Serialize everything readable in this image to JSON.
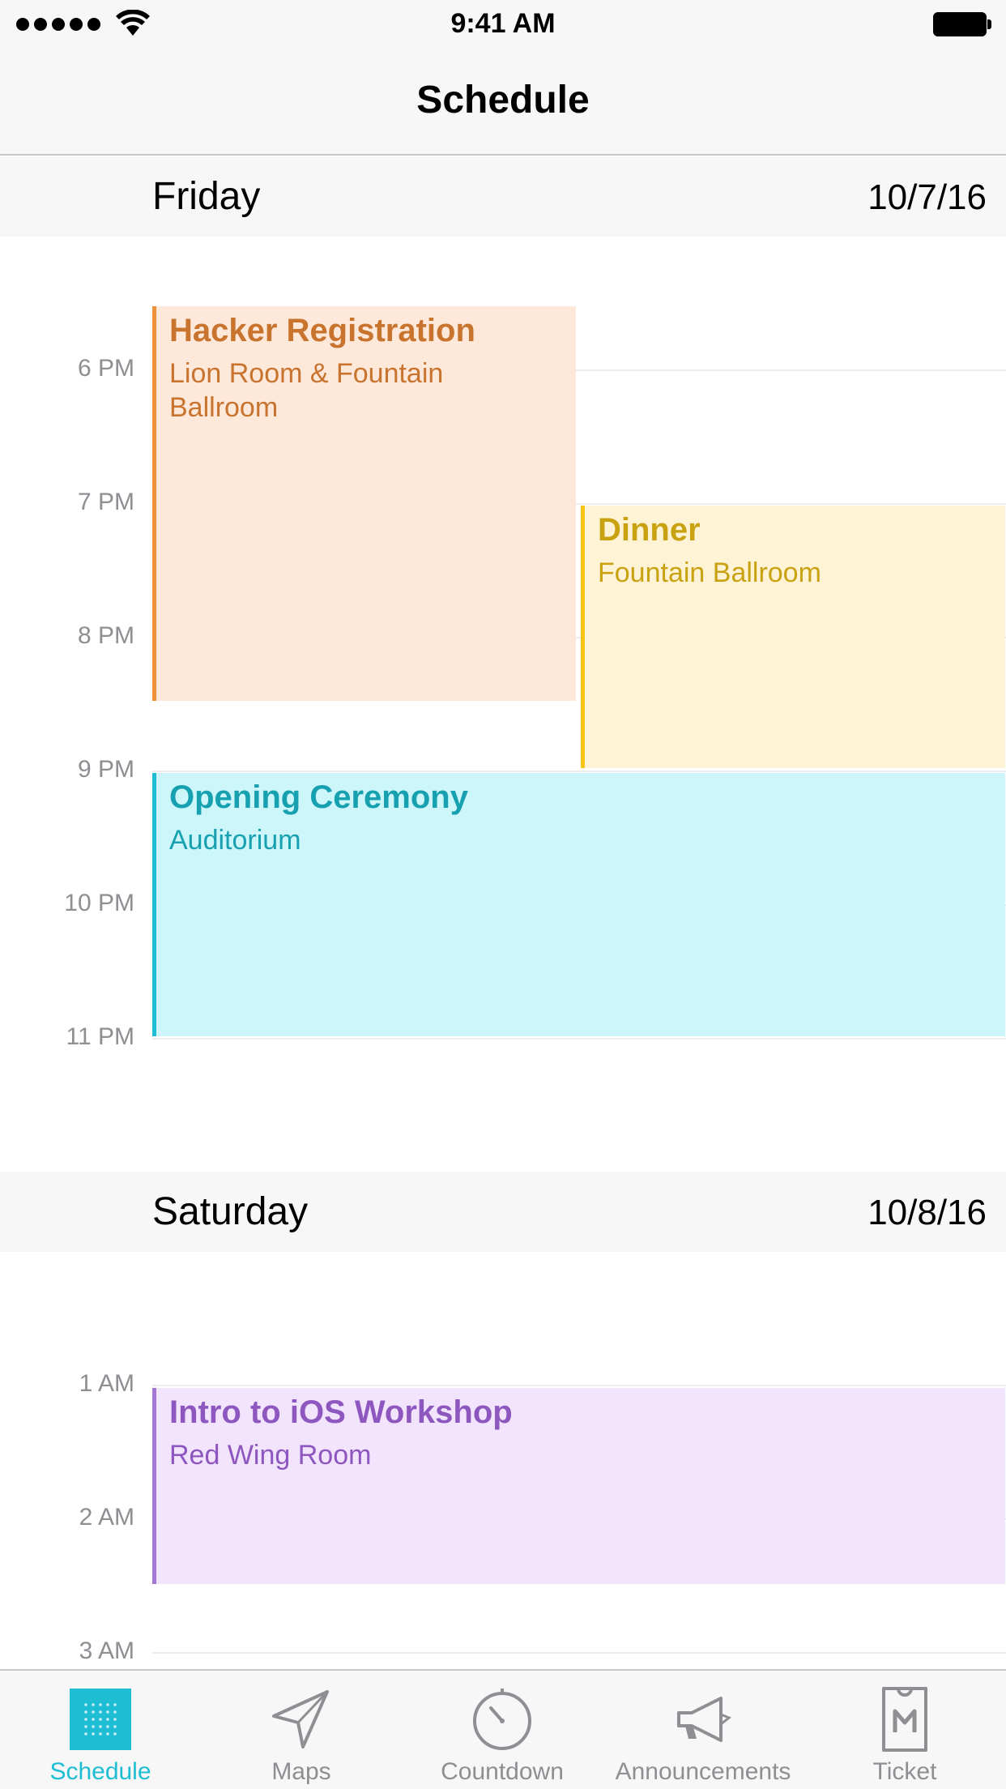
{
  "status_bar": {
    "time": "9:41 AM"
  },
  "nav": {
    "title": "Schedule"
  },
  "days": [
    {
      "name": "Friday",
      "date": "10/7/16",
      "hours": [
        "6 PM",
        "7 PM",
        "8 PM",
        "9 PM",
        "10 PM",
        "11 PM"
      ],
      "events": [
        {
          "title": "Hacker Registration",
          "location_line1": "Lion Room & Fountain",
          "location_line2": "Ballroom"
        },
        {
          "title": "Dinner",
          "location": "Fountain Ballroom"
        },
        {
          "title": "Opening Ceremony",
          "location": "Auditorium"
        }
      ]
    },
    {
      "name": "Saturday",
      "date": "10/8/16",
      "hours": [
        "1 AM",
        "2 AM",
        "3 AM"
      ],
      "events": [
        {
          "title": "Intro to iOS Workshop",
          "location": "Red Wing Room"
        }
      ]
    }
  ],
  "event_colors": {
    "orange": {
      "accent": "#f0913a",
      "fill": "#fde8da",
      "text": "#c9742e"
    },
    "yellow": {
      "accent": "#f5c518",
      "fill": "#fef3d4",
      "text": "#c9a212"
    },
    "cyan": {
      "accent": "#1fbdd3",
      "fill": "#cdf6fb",
      "text": "#17a0b0"
    },
    "purple": {
      "accent": "#a477d6",
      "fill": "#f2e4fc",
      "text": "#8e57bf"
    }
  },
  "tabs": [
    {
      "label": "Schedule",
      "icon": "calendar-grid-icon",
      "active": true
    },
    {
      "label": "Maps",
      "icon": "location-arrow-icon",
      "active": false
    },
    {
      "label": "Countdown",
      "icon": "stopwatch-icon",
      "active": false
    },
    {
      "label": "Announcements",
      "icon": "megaphone-icon",
      "active": false
    },
    {
      "label": "Ticket",
      "icon": "ticket-icon",
      "active": false
    }
  ]
}
